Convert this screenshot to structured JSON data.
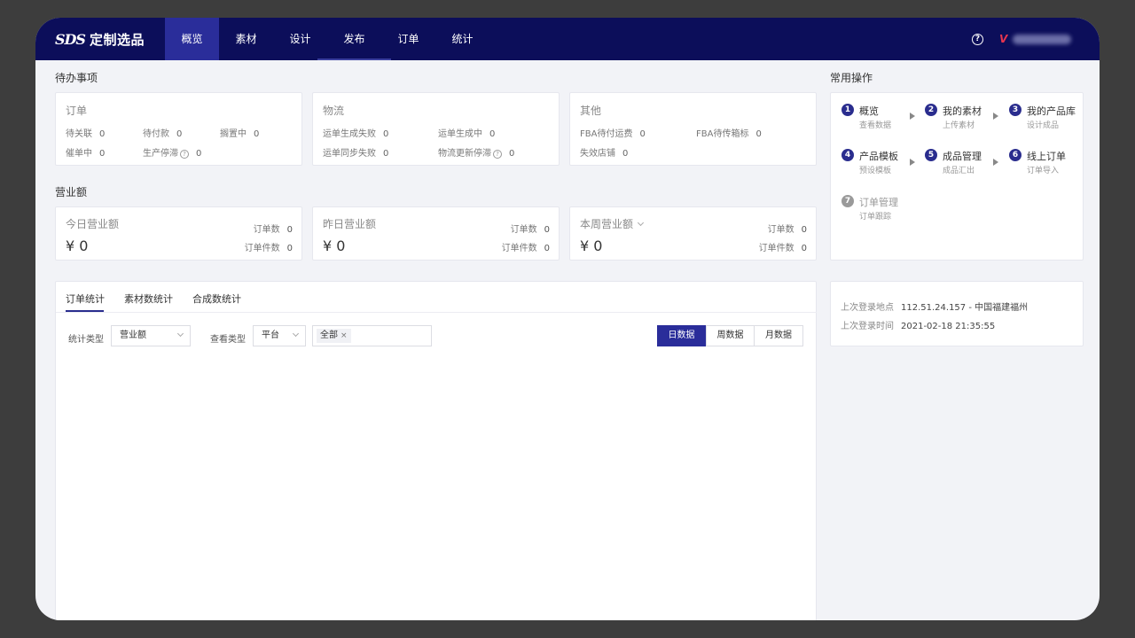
{
  "header": {
    "logo_mark": "SDS",
    "logo_text": "定制选品",
    "nav": [
      {
        "label": "概览"
      },
      {
        "label": "素材"
      },
      {
        "label": "设计"
      },
      {
        "label": "发布"
      },
      {
        "label": "订单"
      },
      {
        "label": "统计"
      }
    ],
    "active_nav": "概览",
    "help_icon": "question-circle-icon",
    "vip_badge": "V"
  },
  "todo": {
    "title": "待办事项",
    "cards": [
      {
        "title": "订单",
        "items": [
          {
            "label": "待关联",
            "value": "0"
          },
          {
            "label": "待付款",
            "value": "0"
          },
          {
            "label": "搁置中",
            "value": "0"
          },
          {
            "label": "催单中",
            "value": "0"
          },
          {
            "label": "生产停滞",
            "value": "0",
            "has_help": true
          }
        ]
      },
      {
        "title": "物流",
        "items": [
          {
            "label": "运单生成失败",
            "value": "0"
          },
          {
            "label": "运单生成中",
            "value": "0"
          },
          {
            "label": "运单同步失败",
            "value": "0"
          },
          {
            "label": "物流更新停滞",
            "value": "0",
            "has_help": true
          }
        ]
      },
      {
        "title": "其他",
        "items": [
          {
            "label": "FBA待付运费",
            "value": "0"
          },
          {
            "label": "FBA待传箱标",
            "value": "0"
          },
          {
            "label": "失效店铺",
            "value": "0"
          }
        ]
      }
    ]
  },
  "revenue": {
    "title": "营业额",
    "cards": [
      {
        "title": "今日营业额",
        "amount": "¥ 0",
        "orders_label": "订单数",
        "orders": "0",
        "items_label": "订单件数",
        "items": "0"
      },
      {
        "title": "昨日营业额",
        "amount": "¥ 0",
        "orders_label": "订单数",
        "orders": "0",
        "items_label": "订单件数",
        "items": "0"
      },
      {
        "title": "本周营业额",
        "amount": "¥ 0",
        "orders_label": "订单数",
        "orders": "0",
        "items_label": "订单件数",
        "items": "0",
        "has_dropdown": true
      }
    ]
  },
  "common_ops": {
    "title": "常用操作",
    "items": [
      {
        "num": "1",
        "title": "概览",
        "sub": "查看数据"
      },
      {
        "num": "2",
        "title": "我的素材",
        "sub": "上传素材"
      },
      {
        "num": "3",
        "title": "我的产品库",
        "sub": "设计成品"
      },
      {
        "num": "4",
        "title": "产品模板",
        "sub": "预设模板"
      },
      {
        "num": "5",
        "title": "成品管理",
        "sub": "成品汇出"
      },
      {
        "num": "6",
        "title": "线上订单",
        "sub": "订单导入"
      },
      {
        "num": "7",
        "title": "订单管理",
        "sub": "订单跟踪",
        "disabled": true
      }
    ]
  },
  "stats": {
    "tabs": [
      {
        "label": "订单统计"
      },
      {
        "label": "素材数统计"
      },
      {
        "label": "合成数统计"
      }
    ],
    "active_tab": "订单统计",
    "stat_type_label": "统计类型",
    "stat_type_value": "营业额",
    "view_type_label": "查看类型",
    "view_type_value": "平台",
    "filter_tag": "全部",
    "range_buttons": [
      {
        "label": "日数据"
      },
      {
        "label": "周数据"
      },
      {
        "label": "月数据"
      }
    ],
    "active_range": "日数据"
  },
  "login": {
    "location_label": "上次登录地点",
    "location_value": "112.51.24.157 - 中国福建福州",
    "time_label": "上次登录时间",
    "time_value": "2021-02-18 21:35:55"
  },
  "colors": {
    "nav_bg": "#0c0e5a",
    "accent": "#2a2d9a",
    "page_bg": "#f2f3f7",
    "vip": "#e8354f"
  }
}
